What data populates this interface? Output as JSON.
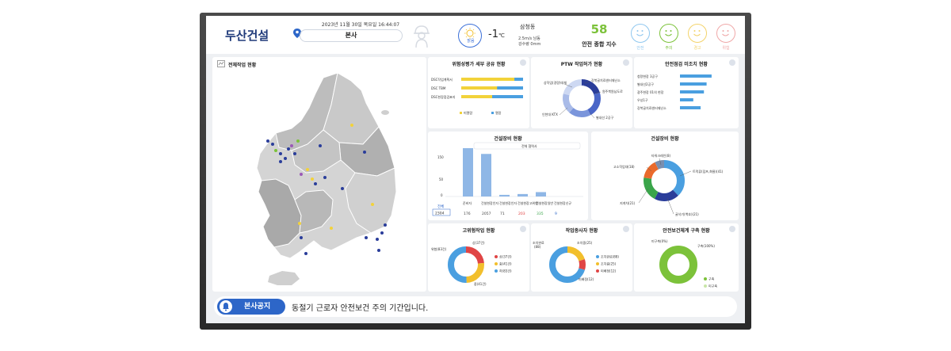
{
  "header": {
    "logo": "두산건설",
    "datetime": "2023년 11월 30일 목요일 16:44:07",
    "location": "본사",
    "weather_label": "맑음",
    "temperature": "-1",
    "temp_unit": "℃",
    "weather_location": "삼청동",
    "wind": "2.5m/s 남동",
    "rain": "강수량 0mm",
    "safety_score": "58",
    "safety_label": "안전 종합 지수",
    "faces": [
      {
        "label": "안전",
        "color": "#8fc7ef"
      },
      {
        "label": "주의",
        "color": "#7cc23a"
      },
      {
        "label": "경고",
        "color": "#f3d36a"
      },
      {
        "label": "위험",
        "color": "#f0a8a8"
      }
    ]
  },
  "panels": {
    "map": {
      "title": "전체작업 현황"
    },
    "risk": {
      "title": "위험성평가 세부 공유 현황",
      "rows": [
        "DSC작업계획서",
        "DSC TBM",
        "DSC현장점검표지"
      ],
      "legend": [
        "미열람",
        "열람"
      ],
      "read": [
        0.86,
        0.58,
        0.5
      ]
    },
    "ptw": {
      "title": "PTW 작업허가 현황",
      "labels": [
        "상작업(경량)대체",
        "강북골치료센터재난소",
        "원주북원남도로",
        "인천대 KTX",
        "별내선 2공구"
      ]
    },
    "unchecked": {
      "title": "안전점검 미조치 현황",
      "rows": [
        "청량현장 3공구",
        "별내선2공구",
        "광주현장 01의 현장",
        "우성1구",
        "강북골치료센터재난소"
      ],
      "values": [
        0.95,
        0.8,
        0.72,
        0.4,
        0.62
      ]
    },
    "equip_bar": {
      "title": "건설장비 현황",
      "select": "전체 협력사",
      "ymax": "150",
      "ymid": "50",
      "ymin": "0",
      "values": [
        176,
        155,
        6,
        9,
        16,
        0
      ],
      "total_label": "전체",
      "total_value": "2304",
      "cols": [
        {
          "label": "준비자",
          "value": "176",
          "color": "#444"
        },
        {
          "label": "건설현장인자",
          "value": "2057",
          "color": "#444"
        },
        {
          "label": "건설현장인자",
          "value": "71",
          "color": "#444"
        },
        {
          "label": "건설현장고위험",
          "value": "203",
          "color": "#e03c3c"
        },
        {
          "label": "건설현장일반",
          "value": "335",
          "color": "#3aa54a"
        },
        {
          "label": "건설현장신규",
          "value": "9",
          "color": "#2d66c8"
        }
      ]
    },
    "equip_pie": {
      "title": "건설장비 현황",
      "labels": [
        "타워크레인(8)",
        "고소작업대(18)",
        "트럭류(덤프,화물)(41)",
        "지게차(21)",
        "굴삭기(백호)(21)"
      ]
    },
    "highrisk": {
      "title": "고위험작업 현황",
      "left_label": "위험(83건)",
      "top_label": "상(37건)",
      "bottom_label": "중(41건)",
      "legend": [
        {
          "label": "상(37건)",
          "color": "#e04545"
        },
        {
          "label": "중(41건)",
          "color": "#f2bf2c"
        },
        {
          "label": "하(83건)",
          "color": "#4a9fe0"
        }
      ]
    },
    "workers": {
      "title": "작업종사자 현황",
      "left_label": "조치완료",
      "left_value": "(88)",
      "top_label": "조치중(25)",
      "bottom_label": "미배정(12)",
      "legend": [
        {
          "label": "조치완료(88)",
          "color": "#4a9fe0"
        },
        {
          "label": "조치중(25)",
          "color": "#f2bf2c"
        },
        {
          "label": "미배정(12)",
          "color": "#e04545"
        }
      ]
    },
    "system": {
      "title": "안전보건체계 구축 현황",
      "left_label": "미구축(0%)",
      "right_label": "구축(100%)",
      "legend": [
        {
          "label": "구축",
          "color": "#7cc23a"
        },
        {
          "label": "미구축",
          "color": "#c8e6a8"
        }
      ]
    }
  },
  "notice": {
    "label": "본사공지",
    "text": "동절기 근로자 안전보건 주의 기간입니다."
  }
}
